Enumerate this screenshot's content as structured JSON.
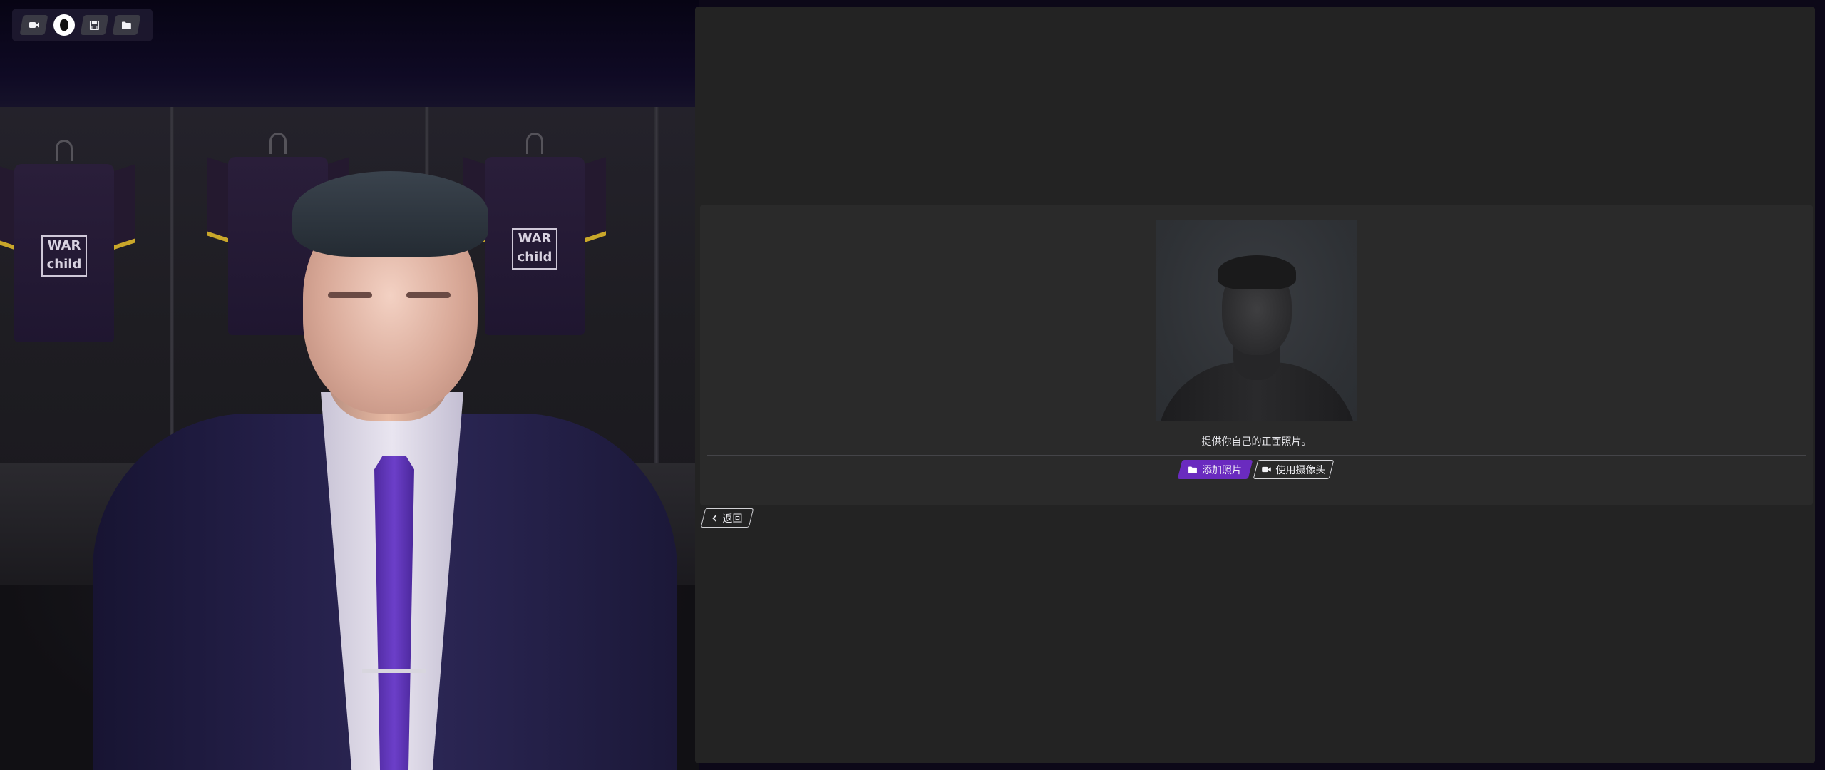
{
  "toolbar": {
    "buttons": [
      {
        "icon": "video-camera-icon",
        "active": false
      },
      {
        "icon": "head-profile-icon",
        "active": true
      },
      {
        "icon": "save-icon",
        "active": false
      },
      {
        "icon": "folder-icon",
        "active": false
      }
    ]
  },
  "scene": {
    "shirt_logo": "WAR child"
  },
  "dialog": {
    "instruction": "提供你自己的正面照片。",
    "add_photo_label": "添加照片",
    "add_photo_icon": "folder-icon",
    "use_camera_label": "使用摄像头",
    "use_camera_icon": "video-camera-icon",
    "back_label": "返回",
    "back_icon": "chevron-left-icon"
  },
  "colors": {
    "accent": "#6a2bbf",
    "panel": "#232323",
    "card": "#2a2a2a"
  }
}
